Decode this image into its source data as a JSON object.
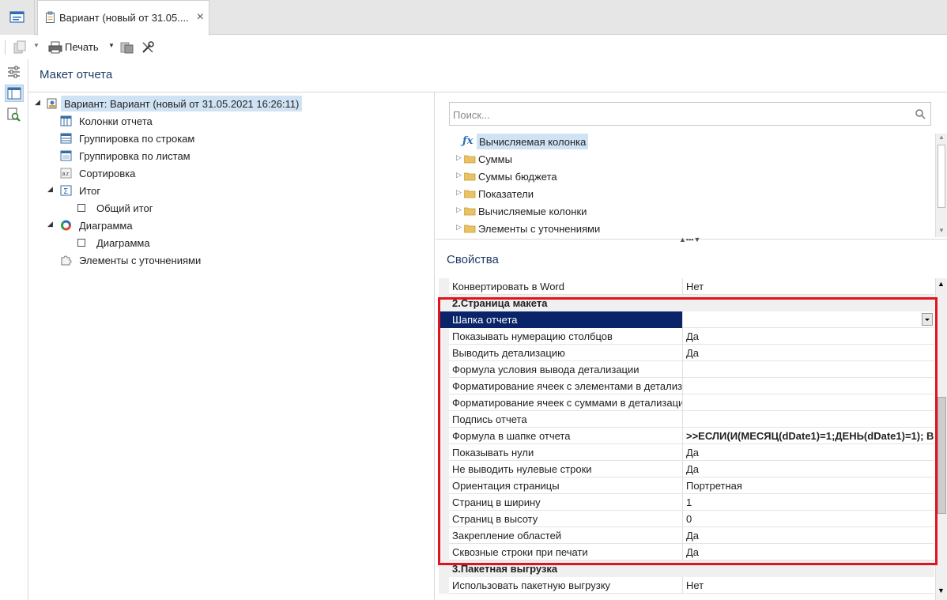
{
  "tabs": {
    "document_tab_label": "Вариант (новый от 31.05....",
    "close_symbol": "×"
  },
  "toolbar": {
    "print_label": "Печать"
  },
  "header": {
    "title": "Макет отчета"
  },
  "left_tree": {
    "root": "Вариант: Вариант (новый от 31.05.2021 16:26:11)",
    "items": {
      "columns": "Колонки отчета",
      "row_grouping": "Группировка по строкам",
      "sheet_grouping": "Группировка по листам",
      "sorting": "Сортировка",
      "total": "Итог",
      "grand_total": "Общий итог",
      "diagram_group": "Диаграмма",
      "diagram_item": "Диаграмма",
      "elements_refine": "Элементы с уточнениями"
    }
  },
  "right_panel": {
    "search_placeholder": "Поиск...",
    "tree": {
      "calc_column": "Вычисляемая колонка",
      "sums": "Суммы",
      "budget_sums": "Суммы бюджета",
      "indicators": "Показатели",
      "calc_columns": "Вычисляемые колонки",
      "elements_refine": "Элементы с уточнениями"
    },
    "props_title": "Свойства"
  },
  "properties": {
    "convert_word": {
      "name": "Конвертировать в Word",
      "value": "Нет"
    },
    "section2": "2.Страница макета",
    "report_header": {
      "name": "Шапка отчета",
      "value": ""
    },
    "show_col_numbers": {
      "name": "Показывать нумерацию столбцов",
      "value": "Да"
    },
    "show_detail": {
      "name": "Выводить детализацию",
      "value": "Да"
    },
    "detail_cond": {
      "name": "Формула условия вывода детализации",
      "value": ""
    },
    "fmt_elements": {
      "name": "Форматирование ячеек с элементами в детализации",
      "value": ""
    },
    "fmt_sums": {
      "name": "Форматирование ячеек с суммами в детализации",
      "value": ""
    },
    "signature": {
      "name": "Подпись отчета",
      "value": ""
    },
    "header_formula": {
      "name": "Формула в шапке отчета",
      "value": ">>ЕСЛИ(И(МЕСЯЦ(dDate1)=1;ДЕНЬ(dDate1)=1); В"
    },
    "show_zeros": {
      "name": "Показывать нули",
      "value": "Да"
    },
    "hide_zero_rows": {
      "name": "Не выводить нулевые строки",
      "value": "Да"
    },
    "orientation": {
      "name": "Ориентация страницы",
      "value": "Портретная"
    },
    "pages_wide": {
      "name": "Страниц в ширину",
      "value": "1"
    },
    "pages_tall": {
      "name": "Страниц в высоту",
      "value": "0"
    },
    "freeze": {
      "name": "Закрепление областей",
      "value": "Да"
    },
    "repeat_rows": {
      "name": "Сквозные строки при печати",
      "value": "Да"
    },
    "section3": "3.Пакетная выгрузка",
    "use_batch": {
      "name": "Использовать пакетную выгрузку",
      "value": "Нет"
    }
  },
  "colors": {
    "accent_blue": "#1f3b66",
    "selection": "#cfe3f5",
    "active_row": "#0a246a",
    "highlight_border": "#e0141e"
  }
}
